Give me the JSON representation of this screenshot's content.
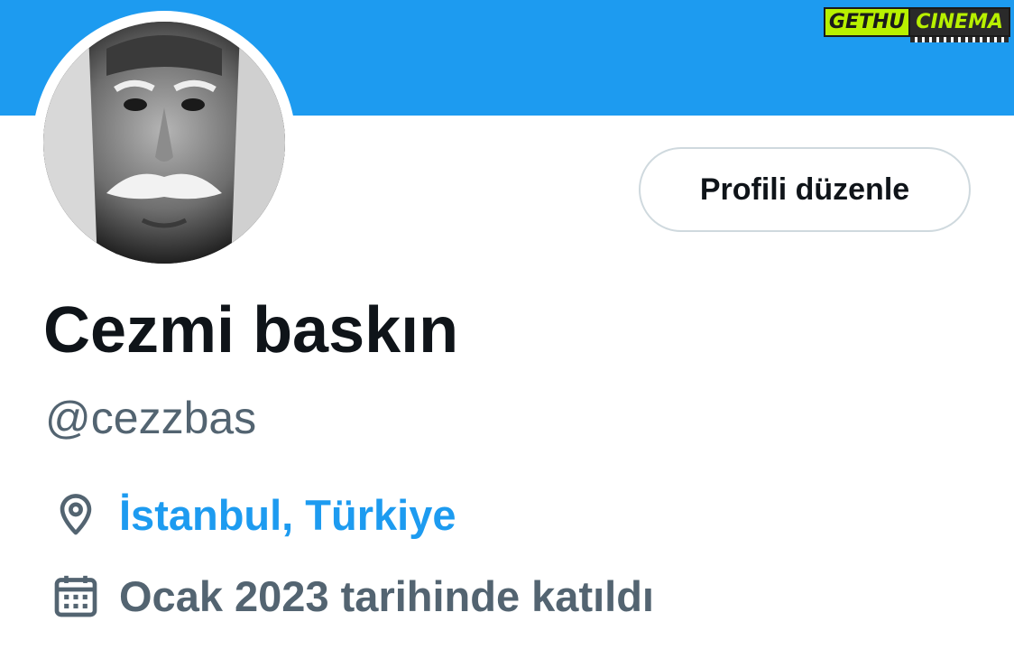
{
  "watermark": {
    "part1": "GETHU",
    "part2": "CINEMA"
  },
  "profile": {
    "display_name": "Cezmi baskın",
    "handle": "@cezzbas",
    "edit_button_label": "Profili düzenle",
    "location": "İstanbul, Türkiye",
    "joined": "Ocak 2023 tarihinde katıldı"
  },
  "icons": {
    "location": "location-pin-icon",
    "joined": "calendar-icon"
  },
  "colors": {
    "banner": "#1d9bf0",
    "link": "#1d9bf0",
    "secondary_text": "#536471",
    "primary_text": "#0f1419",
    "button_border": "#cfd9de"
  }
}
